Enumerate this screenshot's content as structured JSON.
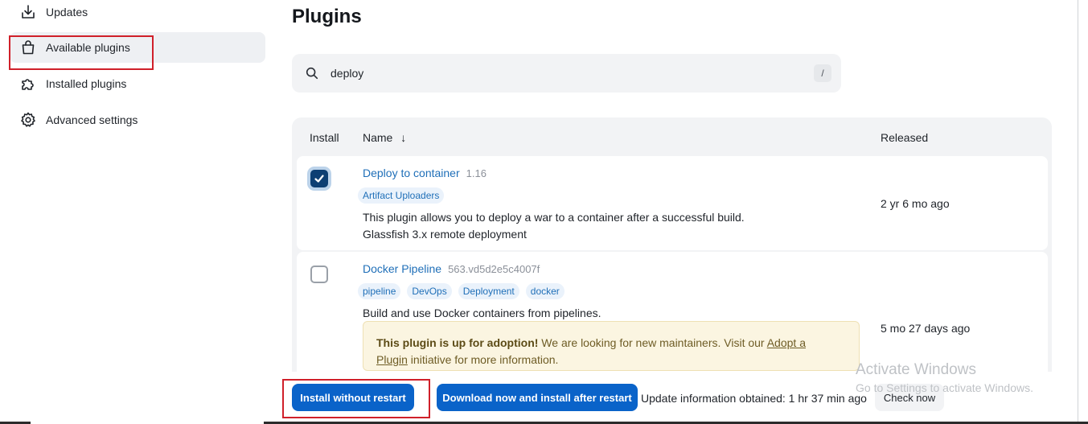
{
  "sidebar": {
    "items": [
      {
        "label": "Updates",
        "icon": "download-icon"
      },
      {
        "label": "Available plugins",
        "icon": "shopping-bag-icon"
      },
      {
        "label": "Installed plugins",
        "icon": "puzzle-icon"
      },
      {
        "label": "Advanced settings",
        "icon": "gear-icon"
      }
    ]
  },
  "main": {
    "title": "Plugins",
    "search": {
      "value": "deploy",
      "shortcut": "/"
    },
    "table": {
      "headers": {
        "install": "Install",
        "name": "Name",
        "sort_indicator": "↓",
        "released": "Released"
      },
      "rows": [
        {
          "checked": true,
          "name": "Deploy to container",
          "version": "1.16",
          "tags": [
            "Artifact Uploaders"
          ],
          "description_line1": "This plugin allows you to deploy a war to a container after a successful build.",
          "description_line2": "Glassfish 3.x remote deployment",
          "released": "2 yr 6 mo ago"
        },
        {
          "checked": false,
          "name": "Docker Pipeline",
          "version": "563.vd5d2e5c4007f",
          "tags": [
            "pipeline",
            "DevOps",
            "Deployment",
            "docker"
          ],
          "description_line1": "Build and use Docker containers from pipelines.",
          "released": "5 mo 27 days ago",
          "adoption": {
            "bold": "This plugin is up for adoption!",
            "text1": " We are looking for new maintainers. Visit our ",
            "link1": "Adopt a",
            "link2": "Plugin",
            "text2": " initiative for more information."
          }
        }
      ]
    }
  },
  "bottom": {
    "install_without_restart": "Install without restart",
    "download_install_after_restart": "Download now and install after restart",
    "update_info": "Update information obtained: 1 hr 37 min ago",
    "check_now": "Check now"
  },
  "watermark": {
    "line1": "Activate Windows",
    "line2": "Go to Settings to activate Windows."
  },
  "colors": {
    "accent": "#0a63c9",
    "link": "#1f6fb8",
    "highlight_box": "#d0202a"
  }
}
